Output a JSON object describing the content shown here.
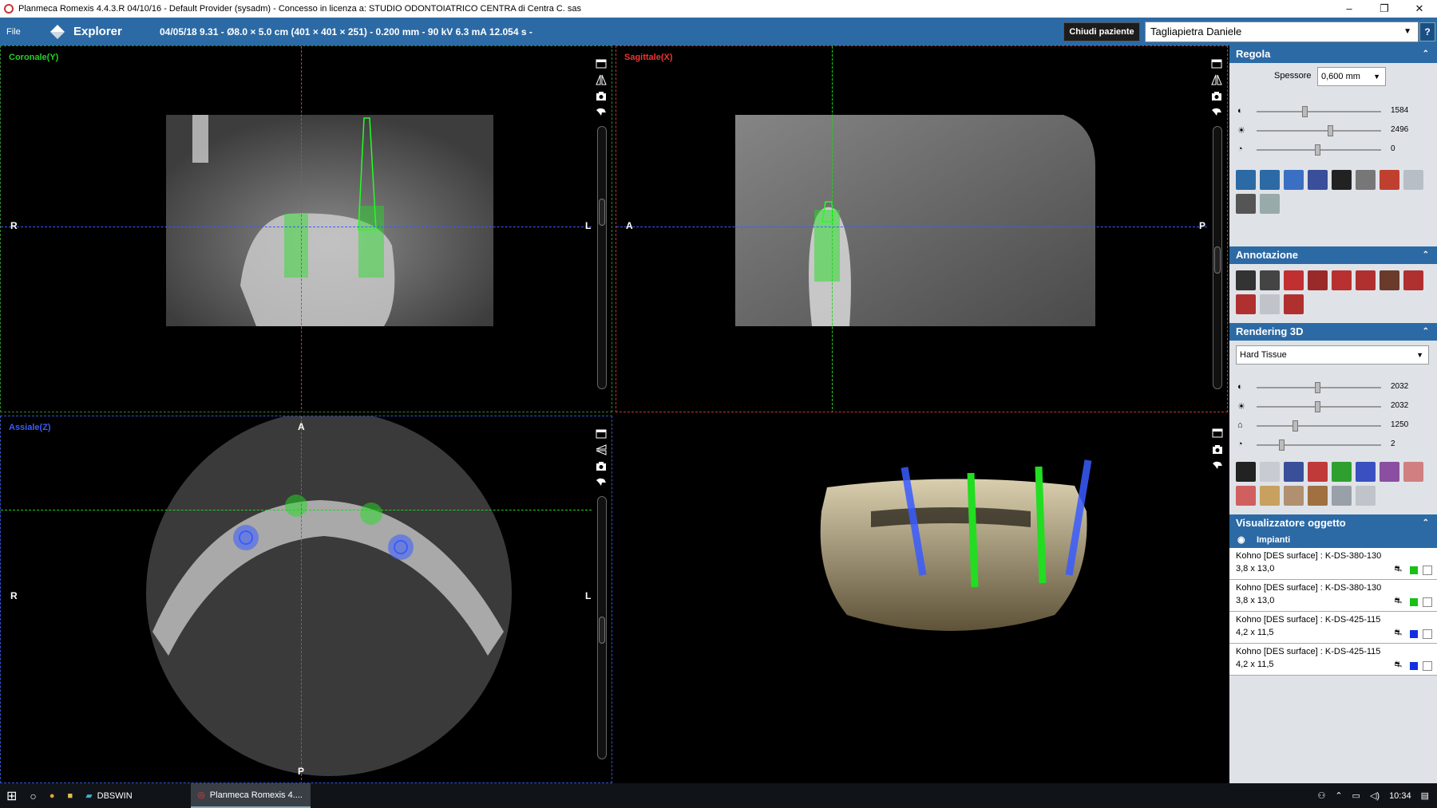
{
  "window": {
    "title": "Planmeca Romexis 4.4.3.R 04/10/16 - Default Provider (sysadm) - Concesso in licenza a: STUDIO ODONTOIATRICO CENTRA di Centra C. sas",
    "minimize": "–",
    "maximize": "❐",
    "close": "✕"
  },
  "appbar": {
    "file": "File",
    "module": "Explorer",
    "scan_info": "04/05/18 9.31 - Ø8.0 × 5.0 cm (401 × 401 × 251) - 0.200 mm - 90 kV 6.3 mA 12.054 s -",
    "close_patient": "Chiudi paziente",
    "patient": "Tagliapietra Daniele",
    "help": "?"
  },
  "views": {
    "coronal": {
      "label": "Coronale(Y)",
      "left": "R",
      "right": "L",
      "color": "#22d022"
    },
    "sagittal": {
      "label": "Sagittale(X)",
      "left": "A",
      "right": "P",
      "color": "#ee3333"
    },
    "axial": {
      "label": "Assiale(Z)",
      "left": "R",
      "right": "L",
      "top": "A",
      "bottom": "P",
      "color": "#3a5cff"
    }
  },
  "sidebar": {
    "regola": {
      "title": "Regola",
      "spessore_label": "Spessore",
      "spessore_value": "0,600 mm",
      "sliders": [
        {
          "icon": "contrast-icon",
          "value": "1584",
          "level": 0.38
        },
        {
          "icon": "brightness-icon",
          "value": "2496",
          "level": 0.6
        },
        {
          "icon": "sharpness-icon",
          "value": "0",
          "level": 0.49
        }
      ]
    },
    "annotazione": {
      "title": "Annotazione"
    },
    "rendering": {
      "title": "Rendering 3D",
      "preset": "Hard Tissue",
      "sliders": [
        {
          "icon": "contrast-icon",
          "value": "2032",
          "level": 0.49
        },
        {
          "icon": "brightness-icon",
          "value": "2032",
          "level": 0.49
        },
        {
          "icon": "threshold-icon",
          "value": "1250",
          "level": 0.3
        },
        {
          "icon": "opacity-icon",
          "value": "2",
          "level": 0.19
        }
      ]
    },
    "visualizzatore": {
      "title": "Visualizzatore oggetto",
      "group": "Impianti",
      "implants": [
        {
          "name": "Kohno [DES surface] : K-DS-380-130",
          "size": "3,8 x 13,0",
          "color": "#18c018"
        },
        {
          "name": "Kohno [DES surface] : K-DS-380-130",
          "size": "3,8 x 13,0",
          "color": "#18c018"
        },
        {
          "name": "Kohno [DES surface] : K-DS-425-115",
          "size": "4,2 x 11,5",
          "color": "#1030e0"
        },
        {
          "name": "Kohno [DES surface] : K-DS-425-115",
          "size": "4,2 x 11,5",
          "color": "#1030e0"
        }
      ]
    }
  },
  "taskbar": {
    "apps": [
      "DBSWIN",
      "Planmeca Romexis 4...."
    ],
    "time": "10:34"
  }
}
